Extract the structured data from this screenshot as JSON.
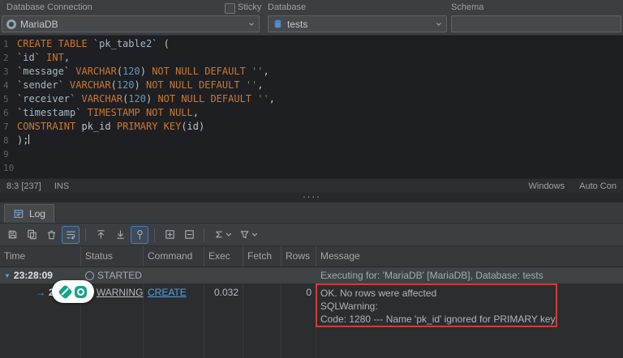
{
  "topbar": {
    "connection_label": "Database Connection",
    "sticky_label": "Sticky",
    "database_label": "Database",
    "schema_label": "Schema",
    "connection_value": "MariaDB",
    "database_value": "tests",
    "schema_value": ""
  },
  "editor": {
    "lines": [
      {
        "n": "1",
        "t": [
          [
            "k",
            "CREATE TABLE "
          ],
          [
            "i",
            "`pk_table2` "
          ],
          [
            "p",
            "("
          ]
        ]
      },
      {
        "n": "2",
        "t": [
          [
            "i",
            "`id` "
          ],
          [
            "k",
            "INT"
          ],
          [
            "p",
            ","
          ]
        ]
      },
      {
        "n": "3",
        "t": [
          [
            "i",
            "`message` "
          ],
          [
            "k",
            "VARCHAR"
          ],
          [
            "p",
            "("
          ],
          [
            "n",
            "120"
          ],
          [
            "p",
            ") "
          ],
          [
            "k",
            "NOT NULL DEFAULT "
          ],
          [
            "s",
            "''"
          ],
          [
            "p",
            ","
          ]
        ]
      },
      {
        "n": "4",
        "t": [
          [
            "i",
            "`sender` "
          ],
          [
            "k",
            "VARCHAR"
          ],
          [
            "p",
            "("
          ],
          [
            "n",
            "120"
          ],
          [
            "p",
            ") "
          ],
          [
            "k",
            "NOT NULL DEFAULT "
          ],
          [
            "s",
            "''"
          ],
          [
            "p",
            ","
          ]
        ]
      },
      {
        "n": "5",
        "t": [
          [
            "i",
            "`receiver` "
          ],
          [
            "k",
            "VARCHAR"
          ],
          [
            "p",
            "("
          ],
          [
            "n",
            "120"
          ],
          [
            "p",
            ") "
          ],
          [
            "k",
            "NOT NULL DEFAULT "
          ],
          [
            "s",
            "''"
          ],
          [
            "p",
            ","
          ]
        ]
      },
      {
        "n": "6",
        "t": [
          [
            "i",
            "`timestamp` "
          ],
          [
            "k",
            "TIMESTAMP NOT NULL"
          ],
          [
            "p",
            ","
          ]
        ]
      },
      {
        "n": "7",
        "t": [
          [
            "k",
            "CONSTRAINT "
          ],
          [
            "p",
            "pk_id "
          ],
          [
            "k",
            "PRIMARY KEY"
          ],
          [
            "p",
            "(id)"
          ]
        ]
      },
      {
        "n": "8",
        "t": [
          [
            "p",
            ");"
          ]
        ],
        "cursor": true
      },
      {
        "n": "9",
        "t": []
      },
      {
        "n": "10",
        "t": []
      }
    ]
  },
  "statusbar": {
    "position": "8:3 [237]",
    "mode": "INS",
    "right1": "Windows",
    "right2": "Auto Con"
  },
  "splitter": {
    "dots": "····"
  },
  "log": {
    "tab_label": "Log",
    "toolbar_icons": [
      "save",
      "copy",
      "delete",
      "soft-wrap",
      "sep",
      "scroll-top",
      "scroll-bottom",
      "pin",
      "sep",
      "expand-all",
      "collapse-all",
      "sep",
      "sigma",
      "filter"
    ],
    "columns": [
      "Time",
      "Status",
      "Command",
      "Exec",
      "Fetch",
      "Rows",
      "Message"
    ],
    "row1": {
      "time": "23:28:09",
      "status": "STARTED",
      "message": "Executing for: 'MariaDB' [MariaDB], Database: tests"
    },
    "row2": {
      "time": "23:2",
      "status": "WARNING",
      "command": "CREATE",
      "exec": "0.032",
      "fetch": "",
      "rows": "0",
      "message_lines": [
        "OK. No rows were affected",
        "SQLWarning:",
        "Code: 1280 --- Name 'pk_id' ignored for PRIMARY key."
      ]
    }
  },
  "colors": {
    "accent_blue": "#4f9ee3",
    "keyword_orange": "#cc7832",
    "string_green": "#6a8759",
    "number_blue": "#6897bb",
    "warning_yellow": "#e2b64d",
    "annotation_red": "#cf3e36",
    "badge_teal": "#14a38b"
  }
}
